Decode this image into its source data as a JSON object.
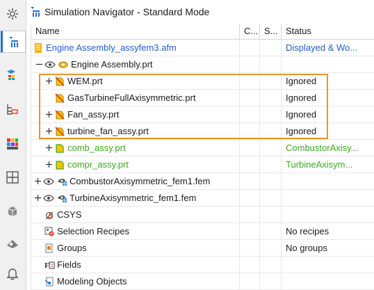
{
  "window": {
    "title": "Simulation Navigator - Standard Mode"
  },
  "toolbar": {
    "buttons": [
      "gear-icon",
      "sim-navigator-icon",
      "fem-icon",
      "assembly-fem-icon",
      "results-icon",
      "layout-icon",
      "part-icon",
      "role-icon",
      "bell-icon"
    ]
  },
  "columns": {
    "name": "Name",
    "c": "C...",
    "s": "S...",
    "status": "Status"
  },
  "rows": [
    {
      "name": "Engine Assembly_assyfem3.afm",
      "status": "Displayed & Wo..."
    },
    {
      "name": "Engine Assembly.prt",
      "status": ""
    },
    {
      "name": "WEM.prt",
      "status": "Ignored"
    },
    {
      "name": "GasTurbineFullAxisymmetric.prt",
      "status": "Ignored"
    },
    {
      "name": "Fan_assy.prt",
      "status": "Ignored"
    },
    {
      "name": "turbine_fan_assy.prt",
      "status": "Ignored"
    },
    {
      "name": "comb_assy.prt",
      "status": "CombustorAxisy..."
    },
    {
      "name": "compr_assy.prt",
      "status": "TurbineAxisym..."
    },
    {
      "name": "CombustorAxisymmetric_fem1.fem",
      "status": ""
    },
    {
      "name": "TurbineAxisymmetric_fem1.fem",
      "status": ""
    },
    {
      "name": "CSYS",
      "status": ""
    },
    {
      "name": "Selection Recipes",
      "status": "No recipes"
    },
    {
      "name": "Groups",
      "status": "No groups"
    },
    {
      "name": "Fields",
      "status": ""
    },
    {
      "name": "Modeling Objects",
      "status": ""
    }
  ],
  "colors": {
    "link_blue": "#1f5fc9",
    "green": "#3aa81e",
    "highlight": "#f0902a"
  }
}
